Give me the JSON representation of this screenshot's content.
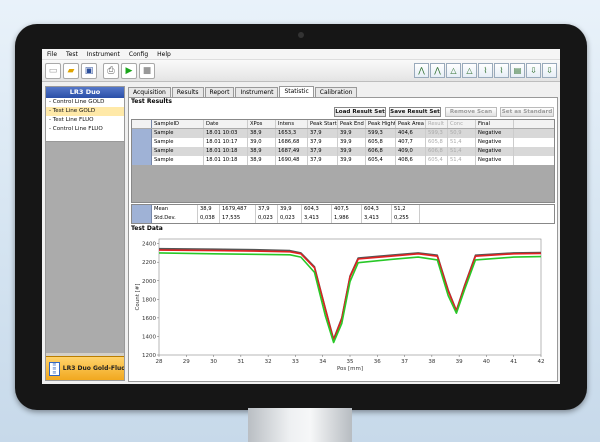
{
  "menu": [
    "File",
    "Test",
    "Instrument",
    "Config",
    "Help"
  ],
  "left_panel": {
    "title": "LR3 Duo",
    "items": [
      "- Control Line GOLD",
      "- Test Line GOLD",
      "- Test Line FLUO",
      "- Control Line FLUO"
    ],
    "selected_index": 1,
    "footer_label": "LR3 Duo Gold-Fluo"
  },
  "tabs": [
    "Acquisition",
    "Results",
    "Report",
    "Instrument",
    "Statistic",
    "Calibration"
  ],
  "active_tab": 4,
  "results": {
    "section_title": "Test Results",
    "buttons": {
      "load": "Load Result Set",
      "save": "Save Result Set",
      "remove": "Remove Scan",
      "standard": "Set as Standard"
    },
    "columns": [
      "SampleID",
      "Date",
      "XPos",
      "Intens",
      "Peak Start",
      "Peak End",
      "Peak Hight",
      "Peak Area",
      "Result",
      "Conc",
      "Final"
    ],
    "rows": [
      [
        "Sample",
        "18.01 10:03",
        "38,9",
        "1653,3",
        "37,9",
        "39,9",
        "599,3",
        "404,6",
        "599,3",
        "50,9",
        "Negative"
      ],
      [
        "Sample",
        "18.01 10:17",
        "39,0",
        "1686,68",
        "37,9",
        "39,9",
        "605,8",
        "407,7",
        "605,8",
        "51,4",
        "Negative"
      ],
      [
        "Sample",
        "18.01 10:18",
        "38,9",
        "1687,49",
        "37,9",
        "39,9",
        "606,8",
        "409,0",
        "606,8",
        "51,4",
        "Negative"
      ],
      [
        "Sample",
        "18.01 10:18",
        "38,9",
        "1690,48",
        "37,9",
        "39,9",
        "605,4",
        "408,6",
        "605,4",
        "51,4",
        "Negative"
      ]
    ],
    "stats": [
      [
        "Mean",
        "38,9",
        "1679,487",
        "37,9",
        "39,9",
        "604,3",
        "407,5",
        "604,3",
        "51,2"
      ],
      [
        "Std.Dev.",
        "0,038",
        "17,535",
        "0,023",
        "0,023",
        "3,413",
        "1,986",
        "3,413",
        "0,255"
      ]
    ]
  },
  "chart_section_title": "Test Data",
  "chart_data": {
    "type": "line",
    "xlabel": "Pos [mm]",
    "ylabel": "Count [#]",
    "xlim": [
      28,
      42
    ],
    "ylim": [
      1200,
      2450
    ],
    "xticks": [
      28,
      29,
      30,
      31,
      32,
      33,
      34,
      35,
      36,
      37,
      38,
      39,
      40,
      41,
      42
    ],
    "yticks": [
      1200,
      1400,
      1600,
      1800,
      2000,
      2200,
      2400
    ],
    "grid": false,
    "series": [
      {
        "color": "#555555",
        "points": [
          [
            28,
            2345
          ],
          [
            30,
            2340
          ],
          [
            31.5,
            2335
          ],
          [
            32.8,
            2325
          ],
          [
            33.2,
            2300
          ],
          [
            33.7,
            2150
          ],
          [
            34.1,
            1700
          ],
          [
            34.4,
            1370
          ],
          [
            34.7,
            1600
          ],
          [
            35.0,
            2050
          ],
          [
            35.3,
            2245
          ],
          [
            36.5,
            2275
          ],
          [
            37.5,
            2300
          ],
          [
            38.2,
            2275
          ],
          [
            38.6,
            1900
          ],
          [
            38.9,
            1680
          ],
          [
            39.2,
            1950
          ],
          [
            39.6,
            2275
          ],
          [
            41,
            2300
          ],
          [
            42,
            2305
          ]
        ]
      },
      {
        "color": "#e02020",
        "points": [
          [
            28,
            2330
          ],
          [
            30,
            2325
          ],
          [
            31.5,
            2320
          ],
          [
            32.8,
            2312
          ],
          [
            33.2,
            2290
          ],
          [
            33.7,
            2140
          ],
          [
            34.1,
            1690
          ],
          [
            34.4,
            1360
          ],
          [
            34.7,
            1590
          ],
          [
            35.0,
            2040
          ],
          [
            35.3,
            2235
          ],
          [
            36.5,
            2265
          ],
          [
            37.5,
            2290
          ],
          [
            38.2,
            2265
          ],
          [
            38.6,
            1890
          ],
          [
            38.9,
            1675
          ],
          [
            39.2,
            1940
          ],
          [
            39.6,
            2265
          ],
          [
            41,
            2290
          ],
          [
            42,
            2295
          ]
        ]
      },
      {
        "color": "#28c828",
        "points": [
          [
            28,
            2300
          ],
          [
            30,
            2290
          ],
          [
            31.5,
            2285
          ],
          [
            32.8,
            2280
          ],
          [
            33.2,
            2255
          ],
          [
            33.7,
            2090
          ],
          [
            34.1,
            1620
          ],
          [
            34.4,
            1335
          ],
          [
            34.7,
            1540
          ],
          [
            35.0,
            1990
          ],
          [
            35.3,
            2195
          ],
          [
            36.5,
            2230
          ],
          [
            37.5,
            2255
          ],
          [
            38.2,
            2225
          ],
          [
            38.6,
            1840
          ],
          [
            38.9,
            1650
          ],
          [
            39.2,
            1905
          ],
          [
            39.6,
            2225
          ],
          [
            41,
            2255
          ],
          [
            42,
            2260
          ]
        ]
      }
    ]
  }
}
